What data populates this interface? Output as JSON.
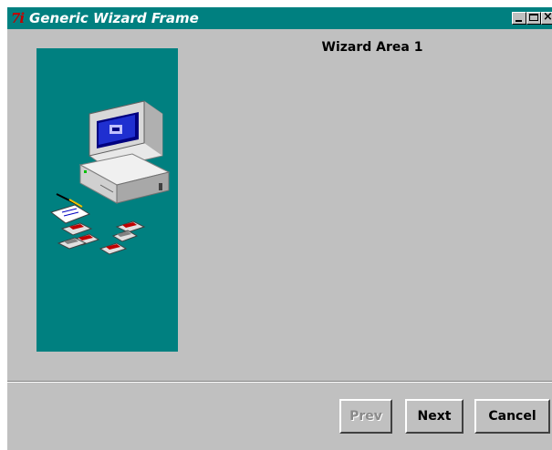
{
  "window": {
    "app_icon_text": "7i",
    "title": "Generic Wizard Frame",
    "controls": {
      "minimize_icon": "minimize-icon",
      "maximize_icon": "maximize-icon",
      "close_icon": "close-icon",
      "close_glyph": "×"
    },
    "titlebar_color": "#008080"
  },
  "side_panel": {
    "background": "#008080",
    "illustration": "computer-with-floppy-disks-illustration"
  },
  "wizard_area": {
    "title": "Wizard Area 1"
  },
  "buttons": {
    "prev": {
      "label": "Prev",
      "enabled": false
    },
    "next": {
      "label": "Next",
      "enabled": true
    },
    "cancel": {
      "label": "Cancel",
      "enabled": true
    }
  }
}
